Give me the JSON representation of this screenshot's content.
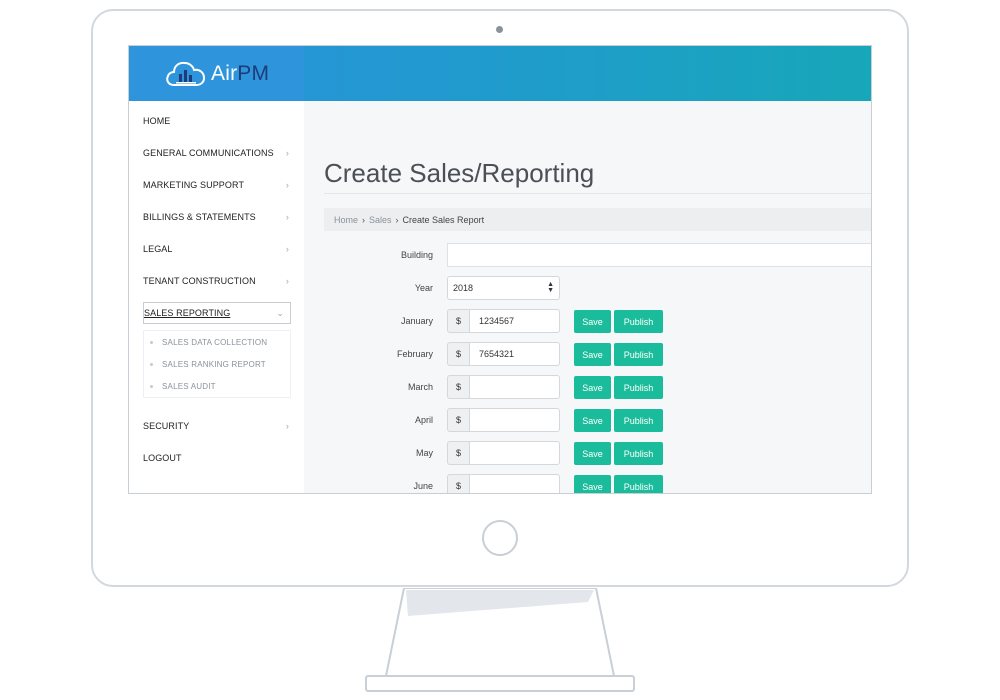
{
  "app": {
    "logo_prefix": "Air",
    "logo_suffix": "PM"
  },
  "sidebar": {
    "items": [
      {
        "label": "HOME",
        "chevron": ""
      },
      {
        "label": "GENERAL COMMUNICATIONS",
        "chevron": "›"
      },
      {
        "label": "MARKETING SUPPORT",
        "chevron": "›"
      },
      {
        "label": "BILLINGS & STATEMENTS",
        "chevron": "›"
      },
      {
        "label": "LEGAL",
        "chevron": "›"
      },
      {
        "label": "TENANT CONSTRUCTION",
        "chevron": "›"
      },
      {
        "label": "SALES REPORTING",
        "chevron": "⌄"
      },
      {
        "label": "SECURITY",
        "chevron": "›"
      },
      {
        "label": "LOGOUT",
        "chevron": ""
      }
    ],
    "submenu": [
      {
        "label": "SALES DATA COLLECTION"
      },
      {
        "label": "SALES RANKING REPORT"
      },
      {
        "label": "SALES AUDIT"
      }
    ]
  },
  "main": {
    "title": "Create Sales/Reporting",
    "breadcrumb": {
      "home": "Home",
      "sales": "Sales",
      "current": "Create Sales Report",
      "separator": "›"
    },
    "form": {
      "building_label": "Building",
      "building_value": "",
      "year_label": "Year",
      "year_value": "2018",
      "currency": "$",
      "save_label": "Save",
      "publish_label": "Publish",
      "months": [
        {
          "label": "January",
          "value": "1234567"
        },
        {
          "label": "February",
          "value": "7654321"
        },
        {
          "label": "March",
          "value": ""
        },
        {
          "label": "April",
          "value": ""
        },
        {
          "label": "May",
          "value": ""
        },
        {
          "label": "June",
          "value": ""
        }
      ]
    }
  },
  "colors": {
    "accent": "#1bbc9b",
    "header_blue": "#2e95dd",
    "header_teal": "#17a7b9",
    "logo_pm": "#1d3c78"
  }
}
